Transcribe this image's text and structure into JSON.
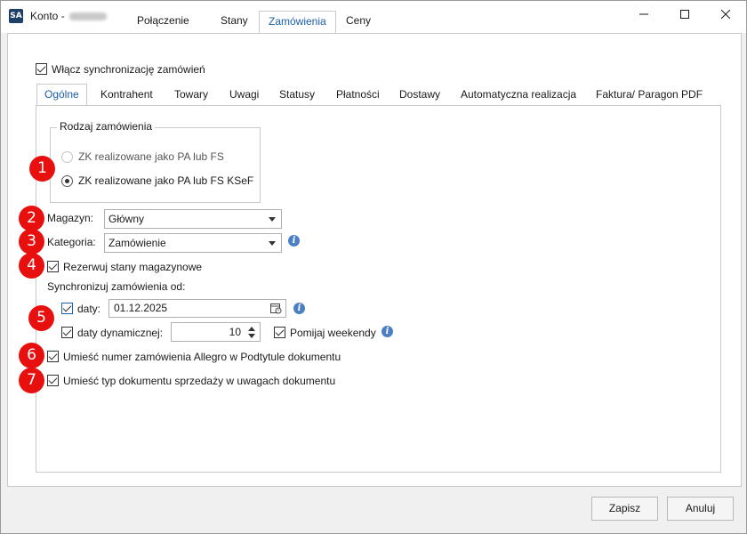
{
  "window": {
    "title": "Konto - ",
    "app_icon_text": "SA",
    "minimize_icon": "minimize-icon",
    "maximize_icon": "maximize-icon",
    "close_icon": "close-icon"
  },
  "main_tabs": [
    "Połączenie",
    "Stany",
    "Zamówienia",
    "Ceny"
  ],
  "main_tab_active": "Zamówienia",
  "sync_orders_label": "Włącz synchronizację zamówień",
  "sub_tabs": [
    "Ogólne",
    "Kontrahent",
    "Towary",
    "Uwagi",
    "Statusy",
    "Płatności",
    "Dostawy",
    "Automatyczna realizacja",
    "Faktura/ Paragon PDF"
  ],
  "sub_tab_active": "Ogólne",
  "order_type": {
    "title": "Rodzaj zamówienia",
    "options": [
      "ZK realizowane jako PA lub FS",
      "ZK realizowane jako PA lub FS KSeF"
    ],
    "selected": "ZK realizowane jako PA lub FS KSeF"
  },
  "warehouse": {
    "label": "Magazyn:",
    "value": "Główny"
  },
  "category": {
    "label": "Kategoria:",
    "value": "Zamówienie"
  },
  "reserve_stock_label": "Rezerwuj stany magazynowe",
  "sync_from_label": "Synchronizuj zamówienia od:",
  "date": {
    "label": "daty:",
    "value": "01.12.2025"
  },
  "dynamic_date": {
    "label": "daty dynamicznej:",
    "value": "10"
  },
  "skip_weekends_label": "Pomijaj weekendy",
  "allegro_subtitle_label": "Umieść numer zamówienia Allegro w Podtytule dokumentu",
  "doc_type_notes_label": "Umieść typ dokumentu sprzedaży w uwagach dokumentu",
  "badges": [
    "1",
    "2",
    "3",
    "4",
    "5",
    "6",
    "7"
  ],
  "buttons": {
    "save": "Zapisz",
    "cancel": "Anuluj"
  },
  "colors": {
    "accent": "#1b5fa8",
    "badge": "#e80f0f",
    "info": "#4a7fc4"
  }
}
